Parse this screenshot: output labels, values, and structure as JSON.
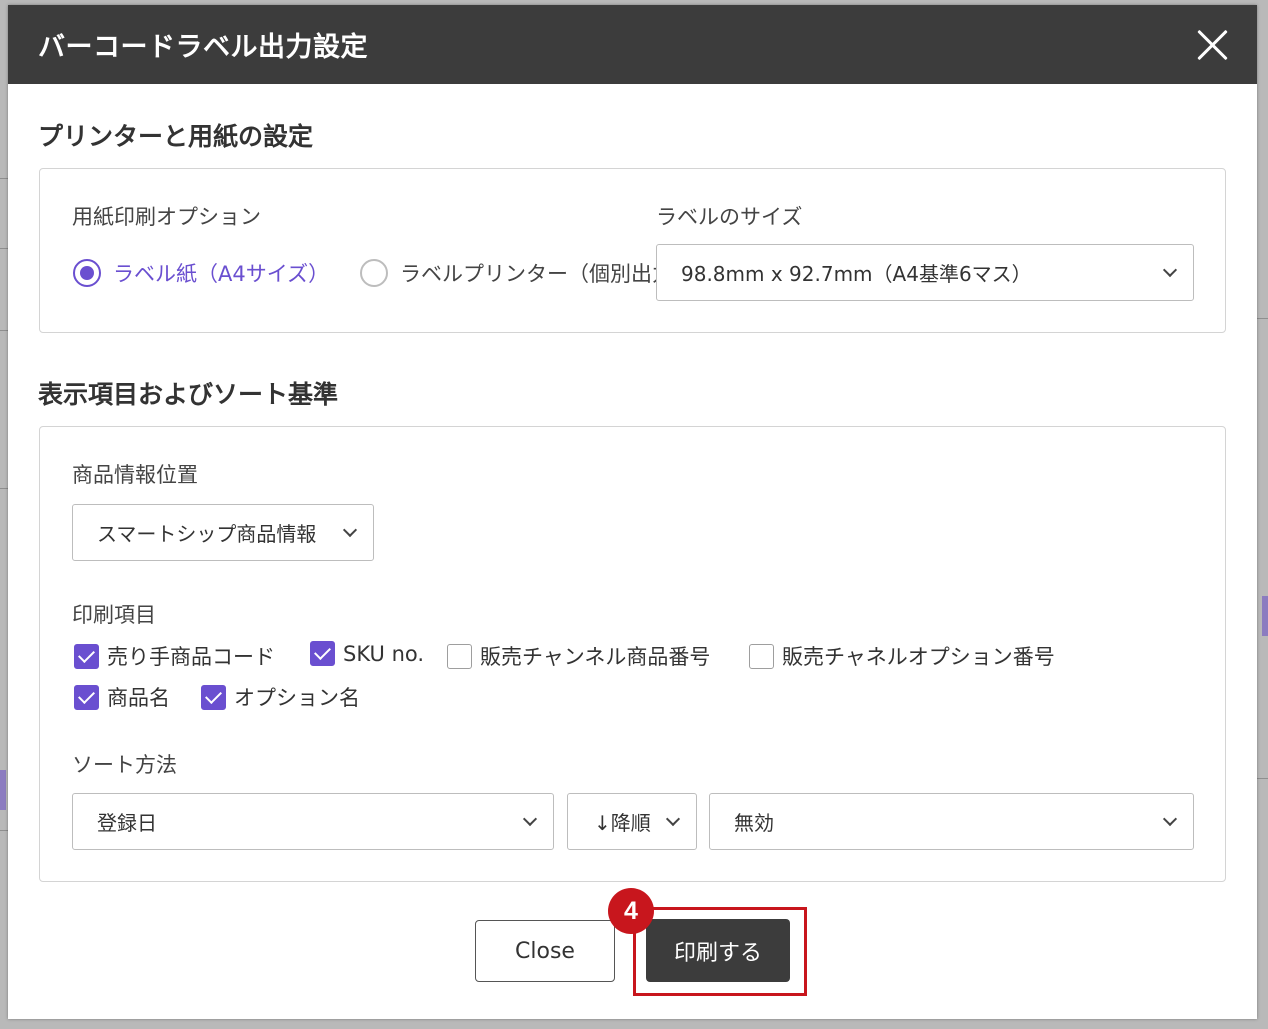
{
  "dialog": {
    "title": "バーコードラベル出力設定"
  },
  "printer_section": {
    "title": "プリンターと用紙の設定",
    "paper_option_label": "用紙印刷オプション",
    "radio_label_paper": "ラベル紙（A4サイズ）",
    "radio_label_printer": "ラベルプリンター（個別出力",
    "selected": "radio_label_paper",
    "label_size_label": "ラベルのサイズ",
    "label_size_value": "98.8mm x 92.7mm（A4基準6マス）"
  },
  "display_section": {
    "title": "表示項目およびソート基準",
    "product_info_position_label": "商品情報位置",
    "product_info_position_value": "スマートシップ商品情報",
    "print_items_label": "印刷項目",
    "print_items": [
      {
        "label": "売り手商品コード",
        "checked": true
      },
      {
        "label": "SKU no.",
        "checked": true
      },
      {
        "label": "販売チャンネル商品番号",
        "checked": false
      },
      {
        "label": "販売チャネルオプション番号",
        "checked": false
      },
      {
        "label": "商品名",
        "checked": true
      },
      {
        "label": "オプション名",
        "checked": true
      }
    ],
    "sort_method_label": "ソート方法",
    "sort_field_value": "登録日",
    "sort_order_value": "↓降順",
    "sort_secondary_value": "無効"
  },
  "footer": {
    "close_label": "Close",
    "print_label": "印刷する",
    "step_number": "4"
  },
  "colors": {
    "accent": "#6a4fd0",
    "header_bg": "#3c3c3c",
    "highlight": "#c8161d"
  }
}
